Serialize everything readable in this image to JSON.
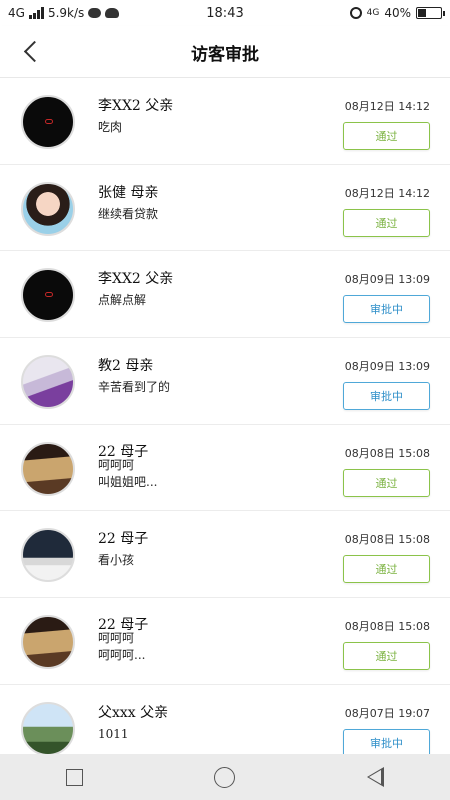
{
  "status_bar": {
    "network": "4G",
    "speed": "5.9k/s",
    "time": "18:43",
    "network_right": "4G",
    "battery": "40%",
    "battery_level": 0.4
  },
  "header": {
    "title": "访客审批"
  },
  "colors": {
    "pass": "#7cb342",
    "pending": "#2f8fc9"
  },
  "visitors": [
    {
      "name": "李XX2 父亲",
      "message": "吃肉",
      "date": "08月12日 14:12",
      "status": "通过",
      "avatar": "dark-logo-icon"
    },
    {
      "name": "张健 母亲",
      "message": "继续看贷款",
      "date": "08月12日 14:12",
      "status": "通过",
      "avatar": "girl-photo"
    },
    {
      "name": "李XX2 父亲",
      "message": "点解点解",
      "date": "08月09日 13:09",
      "status": "审批中",
      "avatar": "dark-logo-icon"
    },
    {
      "name": "教2 母亲",
      "message": "辛苦看到了的",
      "date": "08月09日 13:09",
      "status": "审批中",
      "avatar": "sofa-photo"
    },
    {
      "name": "22 母子",
      "message": "呵呵呵\n叫姐姐吧...",
      "date": "08月08日 15:08",
      "status": "通过",
      "avatar": "desk-photo"
    },
    {
      "name": "22 母子",
      "message": "看小孩",
      "date": "08月08日 15:08",
      "status": "通过",
      "avatar": "monitor-photo"
    },
    {
      "name": "22 母子",
      "message": "呵呵呵\n呵呵呵...",
      "date": "08月08日 15:08",
      "status": "通过",
      "avatar": "desk-photo"
    },
    {
      "name": "父xxx 父亲",
      "message": "1011",
      "date": "08月07日 19:07",
      "status": "审批中",
      "avatar": "landscape-photo"
    }
  ]
}
